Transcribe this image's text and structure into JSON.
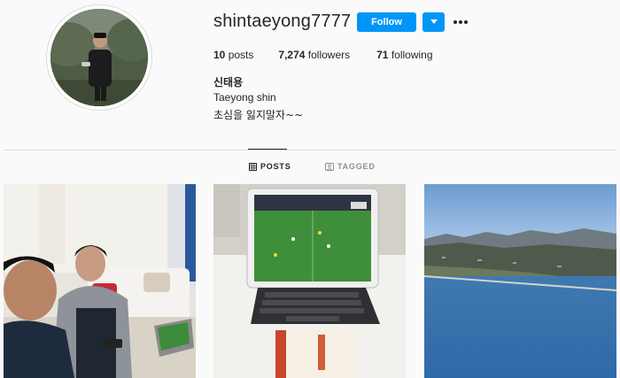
{
  "profile": {
    "username": "shintaeyong7777",
    "follow_label": "Follow",
    "posts_count": "10",
    "posts_label": "posts",
    "followers_count": "7,274",
    "followers_label": "followers",
    "following_count": "71",
    "following_label": "following",
    "full_name": "신태용",
    "bio_line1": "Taeyong shin",
    "bio_line2": "초심을 잃지말자~~"
  },
  "tabs": [
    {
      "label": "POSTS",
      "icon": "grid-icon",
      "active": true
    },
    {
      "label": "TAGGED",
      "icon": "tag-icon",
      "active": false
    }
  ],
  "posts": [
    {
      "subject": "selfie-in-living-room"
    },
    {
      "subject": "tablet-showing-football-match"
    },
    {
      "subject": "coastline-landscape"
    }
  ],
  "colors": {
    "accent": "#0095f6",
    "text": "#262626",
    "muted": "#8e8e8e",
    "divider": "#dbdbdb",
    "background": "#fafafa"
  }
}
